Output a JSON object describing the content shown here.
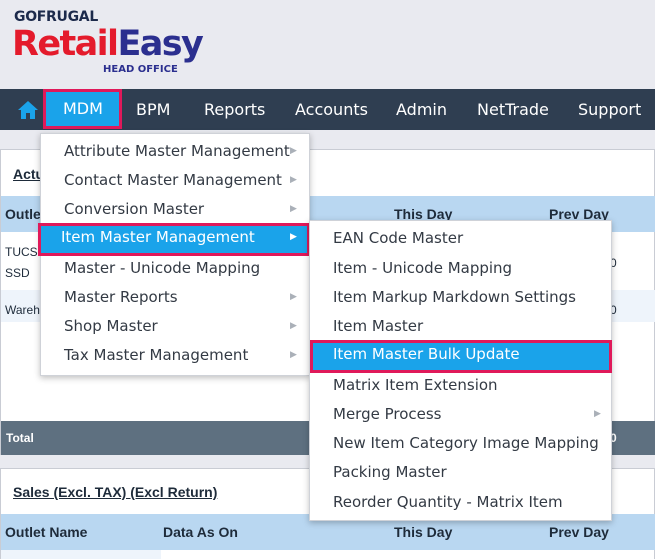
{
  "logo": {
    "brand_top": "GOFRUGAL",
    "brand_retail": "Retail",
    "brand_easy": "Easy",
    "brand_sub": "HEAD OFFICE"
  },
  "nav": {
    "items": [
      "MDM",
      "BPM",
      "Reports",
      "Accounts",
      "Admin",
      "NetTrade",
      "Support"
    ],
    "active": "MDM",
    "accent": "#1aa3ea",
    "highlight": "#e0195a",
    "bar_color": "#2f3e51"
  },
  "panel1": {
    "title": "Actu",
    "headers": {
      "outlet": "Outle",
      "this_day": "This Day",
      "prev_day": "Prev Day"
    },
    "rows": [
      {
        "outlet_line1": "TUCS",
        "outlet_line2": "SSD",
        "prev_tail": "0"
      },
      {
        "outlet_line1": "Wareh",
        "prev_tail": "0"
      }
    ],
    "total_label": "Total",
    "total_tail": "0"
  },
  "panel2": {
    "title": "Sales (Excl. TAX) (Excl Return)",
    "headers": {
      "outlet": "Outlet Name",
      "data_as_on": "Data As On",
      "this_day": "This Day",
      "prev_day": "Prev Day"
    }
  },
  "mdm_menu": {
    "items": [
      {
        "label": "Attribute Master Management",
        "submenu": true
      },
      {
        "label": "Contact Master Management",
        "submenu": true
      },
      {
        "label": "Conversion Master",
        "submenu": true
      },
      {
        "label": "Item Master Management",
        "submenu": true,
        "active": true
      },
      {
        "label": "Master - Unicode Mapping",
        "submenu": false
      },
      {
        "label": "Master Reports",
        "submenu": true
      },
      {
        "label": "Shop Master",
        "submenu": true
      },
      {
        "label": "Tax Master Management",
        "submenu": true
      }
    ]
  },
  "item_master_menu": {
    "items": [
      {
        "label": "EAN Code Master",
        "submenu": false
      },
      {
        "label": "Item - Unicode Mapping",
        "submenu": false
      },
      {
        "label": "Item Markup Markdown Settings",
        "submenu": false
      },
      {
        "label": "Item Master",
        "submenu": false
      },
      {
        "label": "Item Master Bulk Update",
        "submenu": false,
        "active": true
      },
      {
        "label": "Matrix Item Extension",
        "submenu": false
      },
      {
        "label": "Merge Process",
        "submenu": true
      },
      {
        "label": "New Item Category Image Mapping",
        "submenu": false
      },
      {
        "label": "Packing Master",
        "submenu": false
      },
      {
        "label": "Reorder Quantity - Matrix Item",
        "submenu": false
      }
    ]
  },
  "icons": {
    "home": "home-icon",
    "submenu": "chevron-right-icon"
  }
}
